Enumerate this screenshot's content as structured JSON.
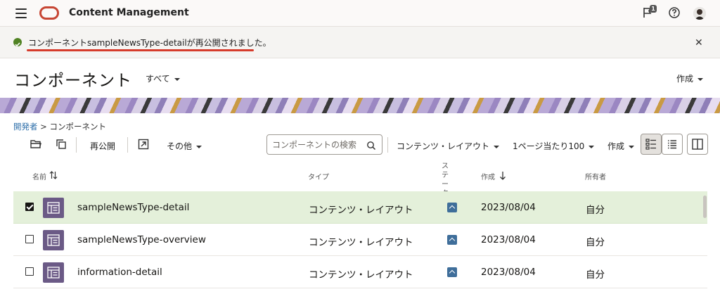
{
  "header": {
    "app_title": "Content Management",
    "notification_count": "1",
    "icons": [
      "menu-icon",
      "oracle-logo",
      "flag-icon",
      "help-icon",
      "avatar"
    ]
  },
  "banner": {
    "message": "コンポーネントsampleNewsType-detailが再公開されました。",
    "status_color": "#508223"
  },
  "page": {
    "title": "コンポーネント",
    "filter_label": "すべて",
    "create_label": "作成"
  },
  "breadcrumb": {
    "parent": "開発者",
    "separator": ">",
    "current": "コンポーネント"
  },
  "toolbar": {
    "republish_label": "再公開",
    "more_label": "その他",
    "search_placeholder": "コンポーネントの検索",
    "type_filter_label": "コンテンツ・レイアウト",
    "per_page_label": "1ページ当たり100",
    "create_label": "作成"
  },
  "table": {
    "headers": {
      "name": "名前",
      "type": "タイプ",
      "status": "ステータス",
      "created": "作成",
      "owner": "所有者"
    },
    "rows": [
      {
        "name": "sampleNewsType-detail",
        "type": "コンテンツ・レイアウト",
        "date": "2023/08/04",
        "owner": "自分",
        "selected": true
      },
      {
        "name": "sampleNewsType-overview",
        "type": "コンテンツ・レイアウト",
        "date": "2023/08/04",
        "owner": "自分",
        "selected": false
      },
      {
        "name": "information-detail",
        "type": "コンテンツ・レイアウト",
        "date": "2023/08/04",
        "owner": "自分",
        "selected": false
      }
    ]
  },
  "colors": {
    "brand_red": "#c74634",
    "selected_row": "#e4f0da",
    "link": "#2e6faa",
    "status_badge": "#3f6e9a",
    "thumb": "#6b5a86"
  }
}
